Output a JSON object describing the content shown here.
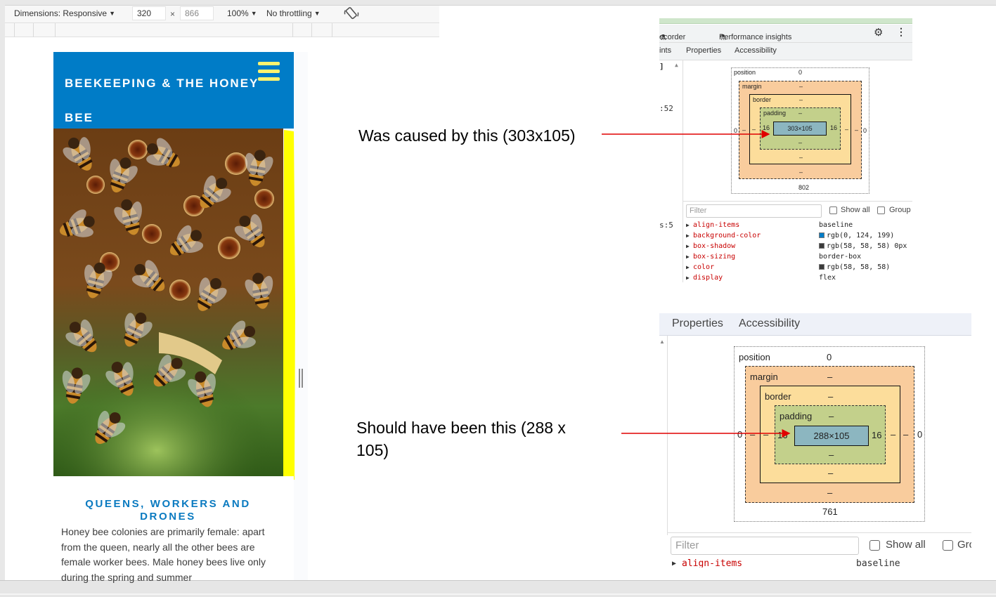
{
  "device_toolbar": {
    "dimensions_label": "Dimensions: Responsive",
    "width_value": "320",
    "times_symbol": "×",
    "height_value": "866",
    "zoom_label": "100%",
    "throttle_label": "No throttling"
  },
  "site": {
    "title": "BEEKEEPING & THE HONEY BEE",
    "section_title": "QUEENS, WORKERS AND DRONES",
    "section_body": "Honey bee colonies are primarily female: apart from the queen, nearly all the other bees are female worker bees. Male honey bees live only during the spring and summer",
    "header_color": "#007cc7",
    "hamburger_color": "#fef36f",
    "highlight_color": "#ffff00"
  },
  "annotations": {
    "first": "Was caused by this (303x105)",
    "second": "Should have been this (288 x 105)",
    "arrow_color": "#e00000"
  },
  "devtools_small": {
    "tabs": {
      "recorder": "ecorder",
      "performance": "Performance insights"
    },
    "subtabs": {
      "left": "ints",
      "properties": "Properties",
      "accessibility": "Accessibility"
    },
    "left_numbers": {
      "a": ":52",
      "b": "s:5"
    },
    "box_model": {
      "position_label": "position",
      "position_value": "0",
      "margin_label": "margin",
      "margin_value": "–",
      "border_label": "border",
      "border_value": "–",
      "padding_label": "padding",
      "padding_value": "–",
      "content": "303×105",
      "padding_left": "16",
      "padding_right": "16",
      "side_value": "0",
      "dash": "–",
      "below": "802"
    },
    "filter_placeholder": "Filter",
    "show_all": "Show all",
    "group": "Group",
    "properties": [
      {
        "name": "align-items",
        "value": "baseline",
        "swatch": ""
      },
      {
        "name": "background-color",
        "value": "rgb(0, 124, 199)",
        "swatch": "#007cc7"
      },
      {
        "name": "box-shadow",
        "value": "rgb(58, 58, 58) 0px",
        "swatch": "#3a3a3a"
      },
      {
        "name": "box-sizing",
        "value": "border-box",
        "swatch": ""
      },
      {
        "name": "color",
        "value": "rgb(58, 58, 58)",
        "swatch": "#3a3a3a"
      },
      {
        "name": "display",
        "value": "flex",
        "swatch": ""
      }
    ]
  },
  "devtools_large": {
    "subtabs": {
      "properties": "Properties",
      "accessibility": "Accessibility"
    },
    "box_model": {
      "position_label": "position",
      "position_value": "0",
      "margin_label": "margin",
      "margin_value": "–",
      "border_label": "border",
      "border_value": "–",
      "padding_label": "padding",
      "padding_value": "–",
      "content": "288×105",
      "padding_left": "16",
      "padding_right": "16",
      "side_value": "0",
      "dash": "–",
      "below": "761"
    },
    "filter_placeholder": "Filter",
    "show_all": "Show all",
    "group": "Gro",
    "first_property": {
      "name": "align-items",
      "value": "baseline"
    }
  },
  "colors": {
    "margin": "#f9cc9d",
    "border": "#fcdd9b",
    "padding": "#c3d08b",
    "content": "#8cb6c0",
    "property_name": "#c80000"
  }
}
